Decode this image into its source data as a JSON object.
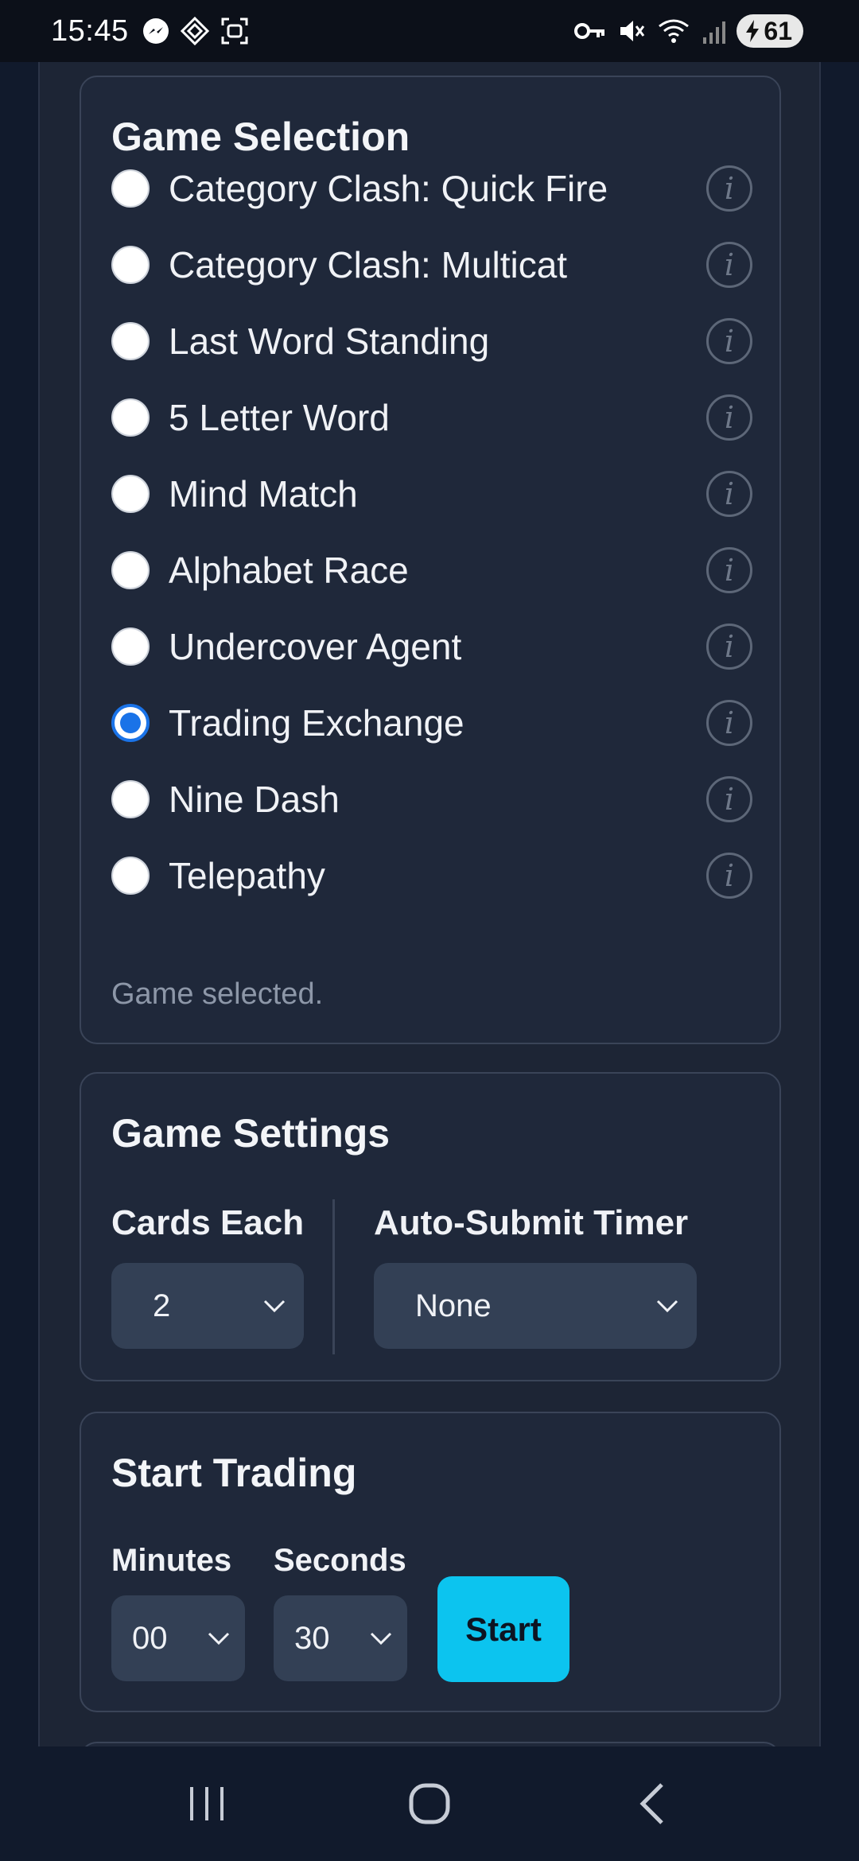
{
  "status_bar": {
    "time": "15:45",
    "icons_left": [
      "messenger-icon",
      "app-icon",
      "screenshot-icon"
    ],
    "icons_right": [
      "key-icon",
      "mute-icon",
      "wifi-icon",
      "signal-icon"
    ],
    "battery": "61"
  },
  "game_selection": {
    "title": "Game Selection",
    "games": [
      {
        "label": "Category Clash: Quick Fire",
        "checked": false
      },
      {
        "label": "Category Clash: Multicat",
        "checked": false
      },
      {
        "label": "Last Word Standing",
        "checked": false
      },
      {
        "label": "5 Letter Word",
        "checked": false
      },
      {
        "label": "Mind Match",
        "checked": false
      },
      {
        "label": "Alphabet Race",
        "checked": false
      },
      {
        "label": "Undercover Agent",
        "checked": false
      },
      {
        "label": "Trading Exchange",
        "checked": true
      },
      {
        "label": "Nine Dash",
        "checked": false
      },
      {
        "label": "Telepathy",
        "checked": false
      }
    ],
    "info_glyph": "i",
    "status": "Game selected."
  },
  "game_settings": {
    "title": "Game Settings",
    "cards_each_label": "Cards Each",
    "cards_each_value": "2",
    "timer_label": "Auto-Submit Timer",
    "timer_value": "None"
  },
  "start_trading": {
    "title": "Start Trading",
    "minutes_label": "Minutes",
    "minutes_value": "00",
    "seconds_label": "Seconds",
    "seconds_value": "30",
    "start_label": "Start"
  },
  "colors": {
    "accent": "#0cc4ef",
    "radio_selected": "#1a73e8",
    "card_bg": "#1f283a",
    "page_bg": "#111a2c"
  }
}
